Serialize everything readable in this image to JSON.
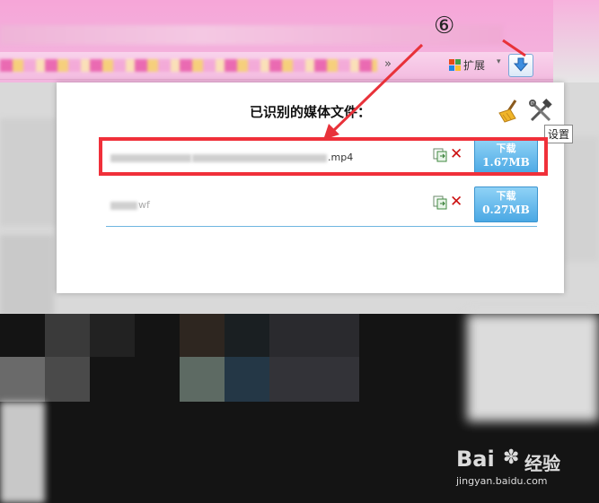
{
  "toolbar": {
    "overflow_chevron": "»",
    "extensions_label": "扩展",
    "dropdown_arrow": "▾"
  },
  "annotation": {
    "step_number": "⑥"
  },
  "popup": {
    "title": "已识别的媒体文件：",
    "tooltip": "设置",
    "items": [
      {
        "name_suffix": ".mp4",
        "download_label": "下载",
        "size": "1.67MB"
      },
      {
        "name_suffix": "wf",
        "download_label": "下载",
        "size": "0.27MB"
      }
    ]
  },
  "watermark": {
    "logo": "Bai",
    "logo_tail": "经验",
    "url": "jingyan.baidu.com"
  },
  "colors": {
    "highlight": "#f0303a",
    "download_button": "#4aa8e4",
    "delete_icon": "#cc1111"
  }
}
